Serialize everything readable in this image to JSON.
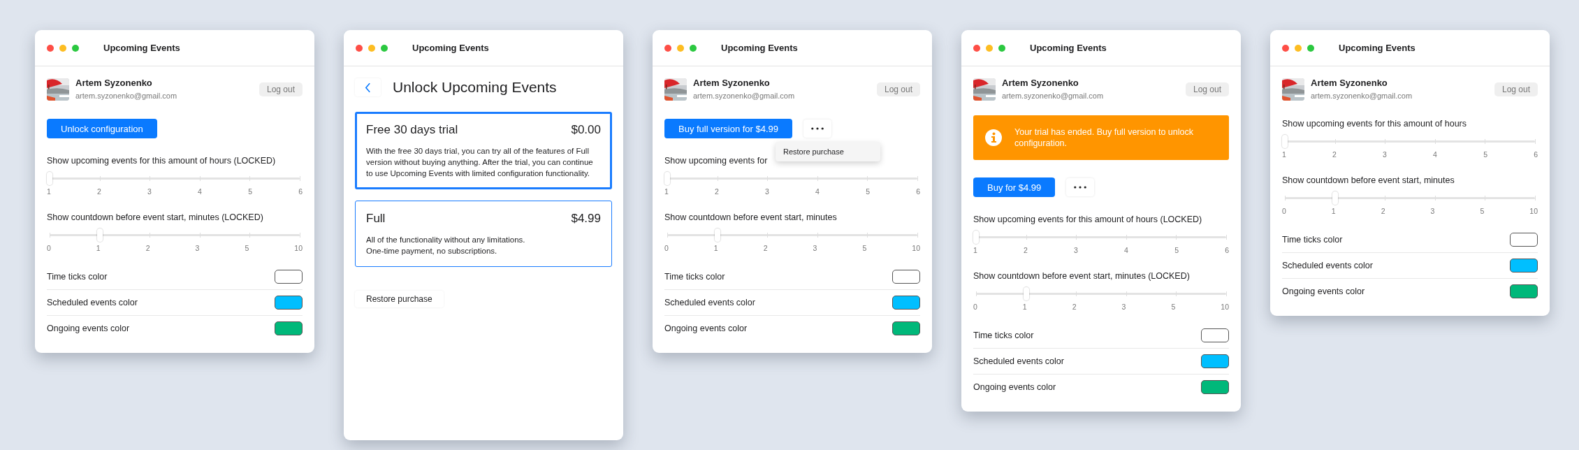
{
  "windows": [
    {
      "kind": "settings",
      "title": "Upcoming Events",
      "account": {
        "name": "Artem Syzonenko",
        "email": "artem.syzonenko@gmail.com",
        "logout": "Log out"
      },
      "primary_button": "Unlock configuration",
      "sliders": [
        {
          "label": "Show upcoming events for this amount of hours (LOCKED)",
          "ticks": [
            "1",
            "2",
            "3",
            "4",
            "5",
            "6"
          ],
          "level": 0
        },
        {
          "label": "Show countdown before event start, minutes (LOCKED)",
          "ticks": [
            "0",
            "1",
            "2",
            "3",
            "5",
            "10"
          ],
          "level": 0.2
        }
      ],
      "colors": [
        {
          "label": "Time ticks color",
          "color": "#ffffff"
        },
        {
          "label": "Scheduled events color",
          "color": "#00bfff"
        },
        {
          "label": "Ongoing events color",
          "color": "#00b87a"
        }
      ]
    },
    {
      "kind": "purchase",
      "title": "Upcoming Events",
      "heading": "Unlock Upcoming Events",
      "plans": [
        {
          "name": "Free 30 days trial",
          "price": "$0.00",
          "description": "With the free 30 days trial, you can try all of the features of Full version without buying anything. After the trial, you can continue to use Upcoming Events with limited configuration functionality.",
          "selected": true
        },
        {
          "name": "Full",
          "price": "$4.99",
          "description": "All of the functionality without any limitations.\nOne-time payment, no subscriptions.",
          "selected": false
        }
      ],
      "restore_button": "Restore purchase"
    },
    {
      "kind": "settings",
      "title": "Upcoming Events",
      "account": {
        "name": "Artem Syzonenko",
        "email": "artem.syzonenko@gmail.com",
        "logout": "Log out"
      },
      "primary_button": "Buy full version for $4.99",
      "more_button": true,
      "menu": {
        "items": [
          "Restore purchase"
        ]
      },
      "sliders": [
        {
          "label": "Show upcoming events for",
          "ticks": [
            "1",
            "2",
            "3",
            "4",
            "5",
            "6"
          ],
          "level": 0
        },
        {
          "label": "Show countdown before event start, minutes",
          "ticks": [
            "0",
            "1",
            "2",
            "3",
            "5",
            "10"
          ],
          "level": 0.2
        }
      ],
      "colors": [
        {
          "label": "Time ticks color",
          "color": "#ffffff"
        },
        {
          "label": "Scheduled events color",
          "color": "#00bfff"
        },
        {
          "label": "Ongoing events color",
          "color": "#00b87a"
        }
      ]
    },
    {
      "kind": "settings",
      "title": "Upcoming Events",
      "account": {
        "name": "Artem Syzonenko",
        "email": "artem.syzonenko@gmail.com",
        "logout": "Log out"
      },
      "alert": {
        "text": "Your trial has ended. Buy full version to unlock configuration."
      },
      "primary_button": "Buy for $4.99",
      "more_button": true,
      "sliders": [
        {
          "label": "Show upcoming events for this amount of hours (LOCKED)",
          "ticks": [
            "1",
            "2",
            "3",
            "4",
            "5",
            "6"
          ],
          "level": 0
        },
        {
          "label": "Show countdown before event start, minutes (LOCKED)",
          "ticks": [
            "0",
            "1",
            "2",
            "3",
            "5",
            "10"
          ],
          "level": 0.2
        }
      ],
      "colors": [
        {
          "label": "Time ticks color",
          "color": "#ffffff"
        },
        {
          "label": "Scheduled events color",
          "color": "#00bfff"
        },
        {
          "label": "Ongoing events color",
          "color": "#00b87a"
        }
      ]
    },
    {
      "kind": "settings",
      "title": "Upcoming Events",
      "account": {
        "name": "Artem Syzonenko",
        "email": "artem.syzonenko@gmail.com",
        "logout": "Log out"
      },
      "sliders": [
        {
          "label": "Show upcoming events for this amount of hours",
          "ticks": [
            "1",
            "2",
            "3",
            "4",
            "5",
            "6"
          ],
          "level": 0
        },
        {
          "label": "Show countdown before event start, minutes",
          "ticks": [
            "0",
            "1",
            "2",
            "3",
            "5",
            "10"
          ],
          "level": 0.2
        }
      ],
      "colors": [
        {
          "label": "Time ticks color",
          "color": "#ffffff"
        },
        {
          "label": "Scheduled events color",
          "color": "#00bfff"
        },
        {
          "label": "Ongoing events color",
          "color": "#00b87a"
        }
      ]
    }
  ]
}
